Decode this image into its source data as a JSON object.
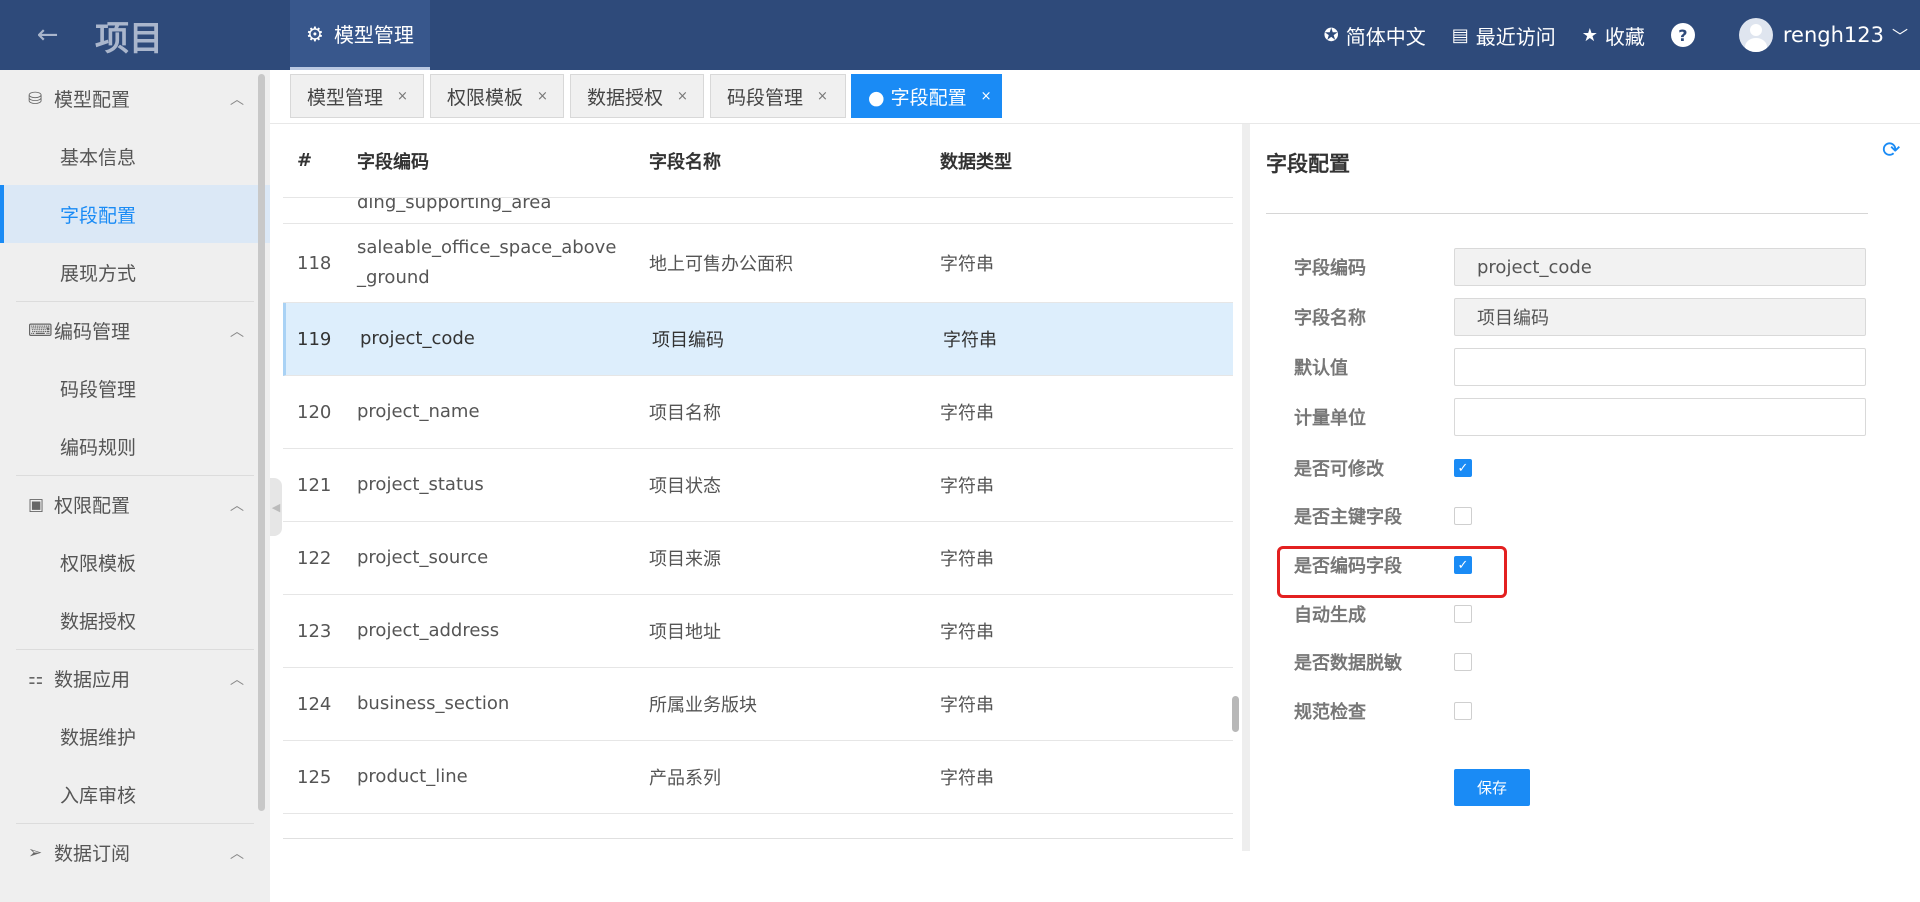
{
  "header": {
    "back_icon": "arrow-left-icon",
    "title": "项目",
    "active_tab": "模型管理",
    "active_tab_icon": "gear-icon",
    "language": "简体中文",
    "recent": "最近访问",
    "favorites": "收藏",
    "help": "?",
    "user": "rengh123"
  },
  "sidebar": {
    "groups": [
      {
        "label": "模型配置",
        "icon": "model-icon",
        "items": [
          {
            "label": "基本信息"
          },
          {
            "label": "字段配置",
            "active": true
          },
          {
            "label": "展现方式"
          }
        ]
      },
      {
        "label": "编码管理",
        "icon": "code-icon",
        "items": [
          {
            "label": "码段管理"
          },
          {
            "label": "编码规则"
          }
        ]
      },
      {
        "label": "权限配置",
        "icon": "permission-icon",
        "items": [
          {
            "label": "权限模板"
          },
          {
            "label": "数据授权"
          }
        ]
      },
      {
        "label": "数据应用",
        "icon": "apps-icon",
        "items": [
          {
            "label": "数据维护"
          },
          {
            "label": "入库审核"
          }
        ]
      },
      {
        "label": "数据订阅",
        "icon": "subscribe-icon",
        "items": []
      }
    ]
  },
  "tabs": [
    {
      "label": "模型管理",
      "close": "×"
    },
    {
      "label": "权限模板",
      "close": "×"
    },
    {
      "label": "数据授权",
      "close": "×"
    },
    {
      "label": "码段管理",
      "close": "×"
    },
    {
      "label": "● 字段配置",
      "close": "×",
      "active": true
    }
  ],
  "table": {
    "headers": [
      "#",
      "字段编码",
      "字段名称",
      "数据类型"
    ],
    "partial_row": {
      "code": "ding_supporting_area"
    },
    "rows": [
      {
        "no": "118",
        "code": "saleable_office_space_above_ground",
        "code_line1": "saleable_office_space_above",
        "code_line2": "_ground",
        "name": "地上可售办公面积",
        "type": "字符串"
      },
      {
        "no": "119",
        "code": "project_code",
        "name": "项目编码",
        "type": "字符串",
        "selected": true
      },
      {
        "no": "120",
        "code": "project_name",
        "name": "项目名称",
        "type": "字符串"
      },
      {
        "no": "121",
        "code": "project_status",
        "name": "项目状态",
        "type": "字符串"
      },
      {
        "no": "122",
        "code": "project_source",
        "name": "项目来源",
        "type": "字符串"
      },
      {
        "no": "123",
        "code": "project_address",
        "name": "项目地址",
        "type": "字符串"
      },
      {
        "no": "124",
        "code": "business_section",
        "name": "所属业务版块",
        "type": "字符串"
      },
      {
        "no": "125",
        "code": "product_line",
        "name": "产品系列",
        "type": "字符串"
      }
    ]
  },
  "panel": {
    "title": "字段配置",
    "refresh_icon": "refresh-icon",
    "field_code_label": "字段编码",
    "field_code_value": "project_code",
    "field_name_label": "字段名称",
    "field_name_value": "项目编码",
    "default_label": "默认值",
    "default_value": "",
    "unit_label": "计量单位",
    "unit_value": "",
    "checkboxes": [
      {
        "label": "是否可修改",
        "checked": true
      },
      {
        "label": "是否主键字段",
        "checked": false
      },
      {
        "label": "是否编码字段",
        "checked": true,
        "highlighted": true
      },
      {
        "label": "自动生成",
        "checked": false
      },
      {
        "label": "是否数据脱敏",
        "checked": false
      },
      {
        "label": "规范检查",
        "checked": false
      }
    ],
    "save": "保存"
  },
  "colors": {
    "header_bg": "#2e4a7a",
    "accent": "#1a8bf5",
    "highlight": "#e32020",
    "selected_row": "#ddeefc"
  }
}
